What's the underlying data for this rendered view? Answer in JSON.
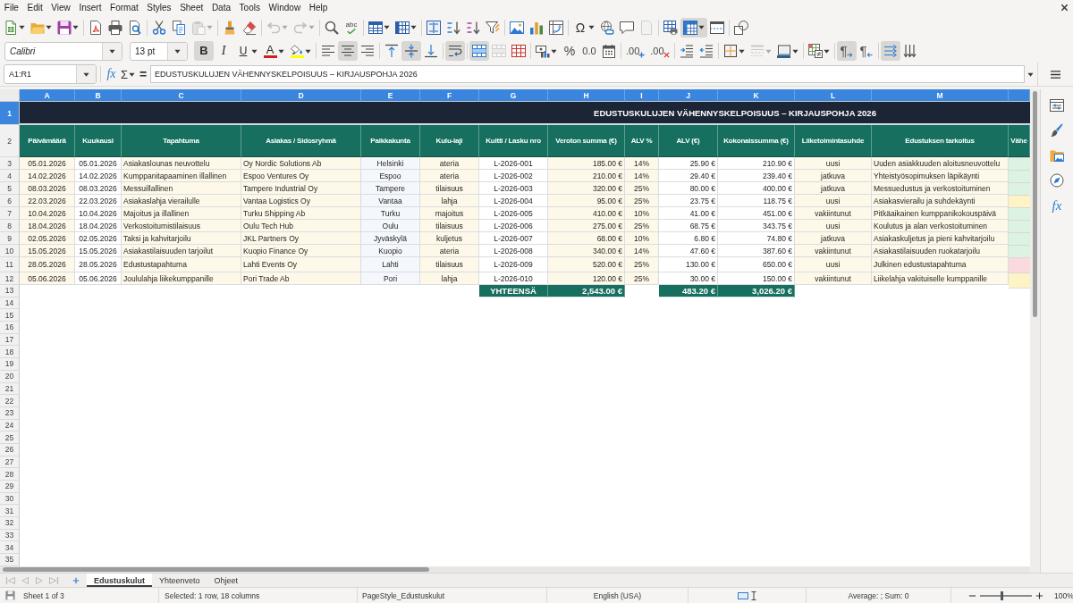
{
  "menu": [
    "File",
    "Edit",
    "View",
    "Insert",
    "Format",
    "Styles",
    "Sheet",
    "Data",
    "Tools",
    "Window",
    "Help"
  ],
  "standard_toolbar": [
    [
      {
        "kind": "new",
        "dropdown": true,
        "on": false,
        "disabled": false
      },
      {
        "kind": "open",
        "dropdown": true,
        "on": false,
        "disabled": false
      },
      {
        "kind": "save",
        "dropdown": true,
        "on": false,
        "disabled": false
      }
    ],
    [
      {
        "kind": "pdf",
        "on": false,
        "disabled": false
      },
      {
        "kind": "print",
        "on": false,
        "disabled": false
      },
      {
        "kind": "preview",
        "on": false,
        "disabled": false
      }
    ],
    [
      {
        "kind": "cut",
        "on": false,
        "disabled": false
      },
      {
        "kind": "copy",
        "on": false,
        "disabled": false
      },
      {
        "kind": "paste",
        "dropdown": true,
        "on": false,
        "disabled": true
      }
    ],
    [
      {
        "kind": "clone",
        "on": false,
        "disabled": false
      },
      {
        "kind": "clear",
        "on": false,
        "disabled": false
      }
    ],
    [
      {
        "kind": "undo",
        "dropdown": true,
        "on": false,
        "disabled": true
      },
      {
        "kind": "redo",
        "dropdown": true,
        "on": false,
        "disabled": true
      }
    ],
    [
      {
        "kind": "find",
        "on": false,
        "disabled": false
      },
      {
        "kind": "spelling",
        "label": "abc",
        "on": false,
        "disabled": false
      }
    ],
    [
      {
        "kind": "rows",
        "dropdown": true,
        "on": false,
        "disabled": false
      },
      {
        "kind": "columns",
        "dropdown": true,
        "on": false,
        "disabled": false
      }
    ],
    [
      {
        "kind": "sort",
        "on": false,
        "disabled": false
      },
      {
        "kind": "sort_ascending",
        "on": false,
        "disabled": false
      },
      {
        "kind": "sort_descending",
        "on": false,
        "disabled": false
      },
      {
        "kind": "filter",
        "on": false,
        "disabled": false
      }
    ],
    [
      {
        "kind": "image",
        "on": false,
        "disabled": false
      },
      {
        "kind": "chart",
        "on": false,
        "disabled": false
      },
      {
        "kind": "pivot",
        "on": false,
        "disabled": false
      }
    ],
    [
      {
        "kind": "special",
        "label": "Ω",
        "dropdown": true,
        "on": false,
        "disabled": false
      },
      {
        "kind": "link",
        "on": false,
        "disabled": false
      },
      {
        "kind": "comment",
        "on": false,
        "disabled": false
      },
      {
        "kind": "header",
        "on": false,
        "disabled": true
      }
    ],
    [
      {
        "kind": "print_area",
        "on": false,
        "disabled": false
      },
      {
        "kind": "freeze",
        "dropdown": true,
        "on": true,
        "disabled": false
      },
      {
        "kind": "split",
        "on": false,
        "disabled": false
      }
    ],
    [
      {
        "kind": "shapes",
        "on": false,
        "disabled": false
      }
    ]
  ],
  "formatting_toolbar": {
    "font_name": "Calibri",
    "font_size": "13 pt",
    "groups": [
      [
        {
          "kind": "bold",
          "label": "B",
          "on": true,
          "disabled": false
        },
        {
          "kind": "italic",
          "label": "I",
          "on": false,
          "disabled": false
        },
        {
          "kind": "underline",
          "label": "U",
          "dropdown": true,
          "on": false,
          "disabled": false
        },
        {
          "kind": "font_color",
          "label": "A",
          "color": "#c9211e",
          "dropdown": true,
          "on": false,
          "disabled": false
        },
        {
          "kind": "highlight",
          "color": "#ffff00",
          "dropdown": true,
          "on": false,
          "disabled": false
        }
      ],
      [
        {
          "kind": "align_left",
          "on": false,
          "disabled": false
        },
        {
          "kind": "align_center",
          "on": true,
          "disabled": false
        },
        {
          "kind": "align_right",
          "on": false,
          "disabled": false
        }
      ],
      [
        {
          "kind": "align_top",
          "on": false,
          "disabled": false
        },
        {
          "kind": "align_middle",
          "on": true,
          "disabled": false
        },
        {
          "kind": "align_bottom",
          "on": false,
          "disabled": false
        }
      ],
      [
        {
          "kind": "wrap",
          "on": true,
          "disabled": false
        }
      ],
      [
        {
          "kind": "merge_center",
          "on": true,
          "disabled": false
        },
        {
          "kind": "merge",
          "on": false,
          "disabled": true
        },
        {
          "kind": "unmerge",
          "on": false,
          "disabled": false
        }
      ],
      [
        {
          "kind": "currency",
          "dropdown": true,
          "on": false,
          "disabled": false
        },
        {
          "kind": "percent",
          "label": "%",
          "on": false,
          "disabled": false
        },
        {
          "kind": "number",
          "label": "0.0",
          "on": false,
          "disabled": false
        },
        {
          "kind": "date",
          "on": false,
          "disabled": false
        }
      ],
      [
        {
          "kind": "add_decimal",
          "label": ".00",
          "on": false,
          "disabled": false
        },
        {
          "kind": "delete_decimal",
          "label": ".00",
          "on": false,
          "disabled": false
        }
      ],
      [
        {
          "kind": "indent_more",
          "on": false,
          "disabled": false
        },
        {
          "kind": "indent_less",
          "on": false,
          "disabled": false
        }
      ],
      [
        {
          "kind": "borders",
          "dropdown": true,
          "on": false,
          "disabled": false
        },
        {
          "kind": "border_style",
          "dropdown": true,
          "on": false,
          "disabled": true
        },
        {
          "kind": "border_color",
          "color": "#2a6099",
          "dropdown": true,
          "on": false,
          "disabled": false
        }
      ],
      [
        {
          "kind": "conditional",
          "dropdown": true,
          "on": false,
          "disabled": false
        }
      ],
      [
        {
          "kind": "para_ltr",
          "label": "¶",
          "on": true,
          "disabled": false
        },
        {
          "kind": "para_rtl",
          "label": "¶",
          "on": false,
          "disabled": false
        }
      ],
      [
        {
          "kind": "text_ltr",
          "on": true,
          "disabled": false
        },
        {
          "kind": "text_vertical",
          "on": false,
          "disabled": false
        }
      ]
    ]
  },
  "formula_bar": {
    "name_box": "A1:R1",
    "function_wizard": "fx",
    "sum": "Σ",
    "equals": "=",
    "content": "EDUSTUSKULUJEN VÄHENNYSKELPOISUUS – KIRJAUSPOHJA 2026"
  },
  "sidebar": {
    "functions": "fx"
  },
  "sheet": {
    "column_headers": [
      {
        "label": "A",
        "selected": true
      },
      {
        "label": "B",
        "selected": true
      },
      {
        "label": "C",
        "selected": true
      },
      {
        "label": "D",
        "selected": true
      },
      {
        "label": "E",
        "selected": true
      },
      {
        "label": "F",
        "selected": true
      },
      {
        "label": "G",
        "selected": true
      },
      {
        "label": "H",
        "selected": true
      },
      {
        "label": "I",
        "selected": true
      },
      {
        "label": "J",
        "selected": true
      },
      {
        "label": "K",
        "selected": true
      },
      {
        "label": "L",
        "selected": true
      },
      {
        "label": "M",
        "selected": true
      },
      {
        "selected": true
      }
    ],
    "row_headers": [
      {
        "label": "1",
        "selected": true
      },
      {
        "label": "2",
        "selected": false
      },
      {
        "label": "3",
        "selected": false
      },
      {
        "label": "4",
        "selected": false
      },
      {
        "label": "5",
        "selected": false
      },
      {
        "label": "6",
        "selected": false
      },
      {
        "label": "7",
        "selected": false
      },
      {
        "label": "8",
        "selected": false
      },
      {
        "label": "9",
        "selected": false
      },
      {
        "label": "10",
        "selected": false
      },
      {
        "label": "11",
        "selected": false
      },
      {
        "label": "12",
        "selected": false
      },
      {
        "label": "13",
        "selected": false
      },
      {
        "label": "14",
        "selected": false
      },
      {
        "label": "15",
        "selected": false
      },
      {
        "label": "16",
        "selected": false
      },
      {
        "label": "17",
        "selected": false
      },
      {
        "label": "18",
        "selected": false
      },
      {
        "label": "19",
        "selected": false
      },
      {
        "label": "20",
        "selected": false
      },
      {
        "label": "21",
        "selected": false
      },
      {
        "label": "22",
        "selected": false
      },
      {
        "label": "23",
        "selected": false
      },
      {
        "label": "24",
        "selected": false
      },
      {
        "label": "25",
        "selected": false
      },
      {
        "label": "26",
        "selected": false
      },
      {
        "label": "27",
        "selected": false
      },
      {
        "label": "28",
        "selected": false
      },
      {
        "label": "29",
        "selected": false
      },
      {
        "label": "30",
        "selected": false
      },
      {
        "label": "31",
        "selected": false
      },
      {
        "label": "32",
        "selected": false
      },
      {
        "label": "33",
        "selected": false
      },
      {
        "label": "34",
        "selected": false
      },
      {
        "label": "35",
        "selected": false
      }
    ],
    "title": "EDUSTUSKULUJEN VÄHENNYSKELPOISUUS – KIRJAUSPOHJA 2026",
    "columns": [
      "Päivämäärä",
      "Kuukausi",
      "Tapahtuma",
      "Asiakas / Sidosryhmä",
      "Paikkakunta",
      "Kulu-laji",
      "Kuitti / Lasku nro",
      "Veroton summa (€)",
      "ALV %",
      "ALV (€)",
      "Kokonaissumma (€)",
      "Liiketoimintasuhde",
      "Edustuksen tarkoitus",
      "Vähe"
    ],
    "rows": [
      {
        "cells": [
          "05.01.2026",
          "05.01.2026",
          "Asiakaslounas neuvottelu",
          "Oy Nordic Solutions Ab",
          "Helsinki",
          "ateria",
          "L-2026-001",
          "185.00 €",
          "14%",
          "25.90 €",
          "210.90 €",
          "uusi",
          "Uuden asiakkuuden aloitusneuvottelu"
        ],
        "color": "#dcf3e2"
      },
      {
        "cells": [
          "14.02.2026",
          "14.02.2026",
          "Kumppanitapaaminen illallinen",
          "Espoo Ventures Oy",
          "Espoo",
          "ateria",
          "L-2026-002",
          "210.00 €",
          "14%",
          "29.40 €",
          "239.40 €",
          "jatkuva",
          "Yhteistyösopimuksen läpikäynti"
        ],
        "color": "#dcf3e2"
      },
      {
        "cells": [
          "08.03.2026",
          "08.03.2026",
          "Messuillallinen",
          "Tampere Industrial Oy",
          "Tampere",
          "tilaisuus",
          "L-2026-003",
          "320.00 €",
          "25%",
          "80.00 €",
          "400.00 €",
          "jatkuva",
          "Messuedustus ja verkostoituminen"
        ],
        "color": "#dcf3e2"
      },
      {
        "cells": [
          "22.03.2026",
          "22.03.2026",
          "Asiakaslahja vierailulle",
          "Vantaa Logistics Oy",
          "Vantaa",
          "lahja",
          "L-2026-004",
          "95.00 €",
          "25%",
          "23.75 €",
          "118.75 €",
          "uusi",
          "Asiakasvierailu ja suhdekäynti"
        ],
        "color": "#fdf3c4"
      },
      {
        "cells": [
          "10.04.2026",
          "10.04.2026",
          "Majoitus ja illallinen",
          "Turku Shipping Ab",
          "Turku",
          "majoitus",
          "L-2026-005",
          "410.00 €",
          "10%",
          "41.00 €",
          "451.00 €",
          "vakiintunut",
          "Pitkäaikainen kumppanikokouspäivä"
        ],
        "color": "#dcf3e2"
      },
      {
        "cells": [
          "18.04.2026",
          "18.04.2026",
          "Verkostoitumistilaisuus",
          "Oulu Tech Hub",
          "Oulu",
          "tilaisuus",
          "L-2026-006",
          "275.00 €",
          "25%",
          "68.75 €",
          "343.75 €",
          "uusi",
          "Koulutus ja alan verkostoituminen"
        ],
        "color": "#dcf3e2"
      },
      {
        "cells": [
          "02.05.2026",
          "02.05.2026",
          "Taksi ja kahvitarjoilu",
          "JKL Partners Oy",
          "Jyväskylä",
          "kuljetus",
          "L-2026-007",
          "68.00 €",
          "10%",
          "6.80 €",
          "74.80 €",
          "jatkuva",
          "Asiakaskuljetus ja pieni kahvitarjoilu"
        ],
        "color": "#dcf3e2"
      },
      {
        "cells": [
          "15.05.2026",
          "15.05.2026",
          "Asiakastilaisuuden tarjoilut",
          "Kuopio Finance Oy",
          "Kuopio",
          "ateria",
          "L-2026-008",
          "340.00 €",
          "14%",
          "47.60 €",
          "387.60 €",
          "vakiintunut",
          "Asiakastilaisuuden ruokatarjoilu"
        ],
        "color": "#dcf3e2"
      },
      {
        "cells": [
          "28.05.2026",
          "28.05.2026",
          "Edustustapahtuma",
          "Lahti Events Oy",
          "Lahti",
          "tilaisuus",
          "L-2026-009",
          "520.00 €",
          "25%",
          "130.00 €",
          "650.00 €",
          "uusi",
          "Julkinen edustustapahtuma"
        ],
        "color": "#fadadd"
      },
      {
        "cells": [
          "05.06.2026",
          "05.06.2026",
          "Joululahja liikekumppanille",
          "Pori Trade Ab",
          "Pori",
          "lahja",
          "L-2026-010",
          "120.00 €",
          "25%",
          "30.00 €",
          "150.00 €",
          "vakiintunut",
          "Liikelahja vakituiselle kumppanille"
        ],
        "color": "#fdf3c4"
      }
    ],
    "totals": {
      "label": "YHTEENSÄ",
      "net_sum": "2,543.00 €",
      "vat_sum": "483.20 €",
      "gross_sum": "3,026.20 €"
    }
  },
  "sheet_navigation": [
    {
      "kind": "first",
      "disabled": true
    },
    {
      "kind": "previous",
      "disabled": true
    },
    {
      "kind": "next",
      "disabled": true
    },
    {
      "kind": "last",
      "disabled": true
    }
  ],
  "sheet_tabs": [
    {
      "label": "Edustuskulut",
      "selected": true
    },
    {
      "label": "Yhteenveto",
      "selected": false
    },
    {
      "label": "Ohjeet",
      "selected": false
    }
  ],
  "status_bar": {
    "sheet": "Sheet 1 of 3",
    "selection": "Selected: 1 row, 18 columns",
    "page_style": "PageStyle_Edustuskulut",
    "language": "English (USA)",
    "summary": "Average: ; Sum: 0",
    "zoom": {
      "level": 0.42,
      "reading": "100%"
    }
  }
}
